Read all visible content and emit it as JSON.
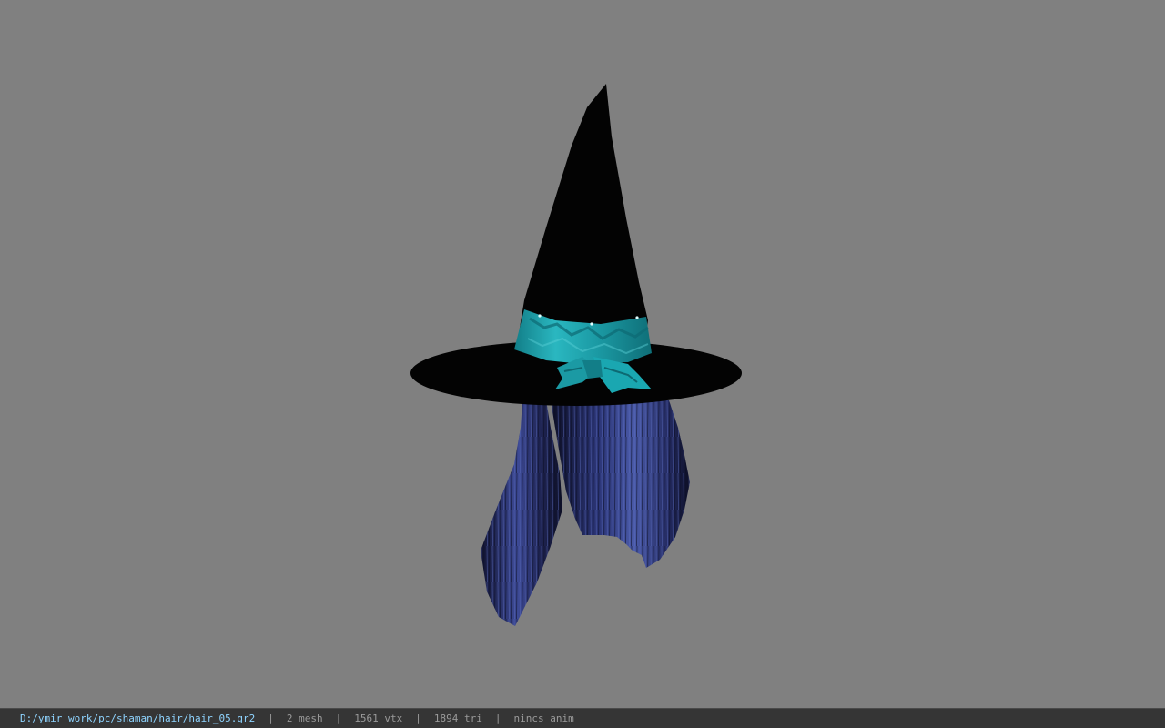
{
  "viewport": {
    "model": "witch-hat-with-hair",
    "background_color": "#808080",
    "colors": {
      "hat": "#030303",
      "ribbon": "#1fa6b0",
      "ribbon_dark": "#0f7a85",
      "hair": "#1b1e4a",
      "hair_highlight": "#4a5aa8"
    }
  },
  "status_bar": {
    "file_path": "D:/ymir work/pc/shaman/hair/hair_05.gr2",
    "separator": "|",
    "mesh_count": "2 mesh",
    "vertex_count": "1561 vtx",
    "triangle_count": "1894 tri",
    "anim_status": "nincs anim"
  }
}
